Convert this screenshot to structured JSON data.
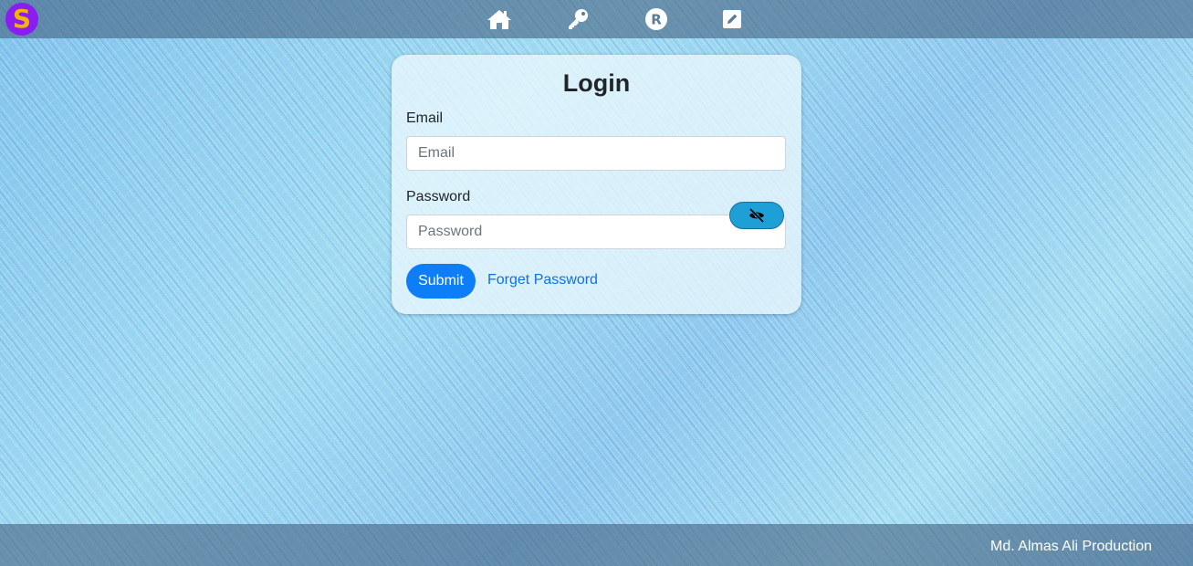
{
  "header": {
    "logo_letter": "S",
    "nav": [
      {
        "name": "home",
        "icon": "home-icon"
      },
      {
        "name": "login",
        "icon": "key-icon"
      },
      {
        "name": "register",
        "icon": "registered-icon"
      },
      {
        "name": "edit",
        "icon": "edit-icon"
      }
    ]
  },
  "login": {
    "title": "Login",
    "email_label": "Email",
    "email_placeholder": "Email",
    "email_value": "",
    "password_label": "Password",
    "password_placeholder": "Password",
    "password_value": "",
    "toggle_icon": "eye-slash-icon",
    "submit_label": "Submit",
    "forget_label": "Forget Password"
  },
  "footer": {
    "credit": "Md. Almas Ali Production"
  },
  "colors": {
    "logo_bg": "#8b1cf2",
    "logo_fg": "#f5b400",
    "primary": "#0d7ef5",
    "link": "#0b72e0",
    "toggle_bg": "#1e9fd6"
  }
}
